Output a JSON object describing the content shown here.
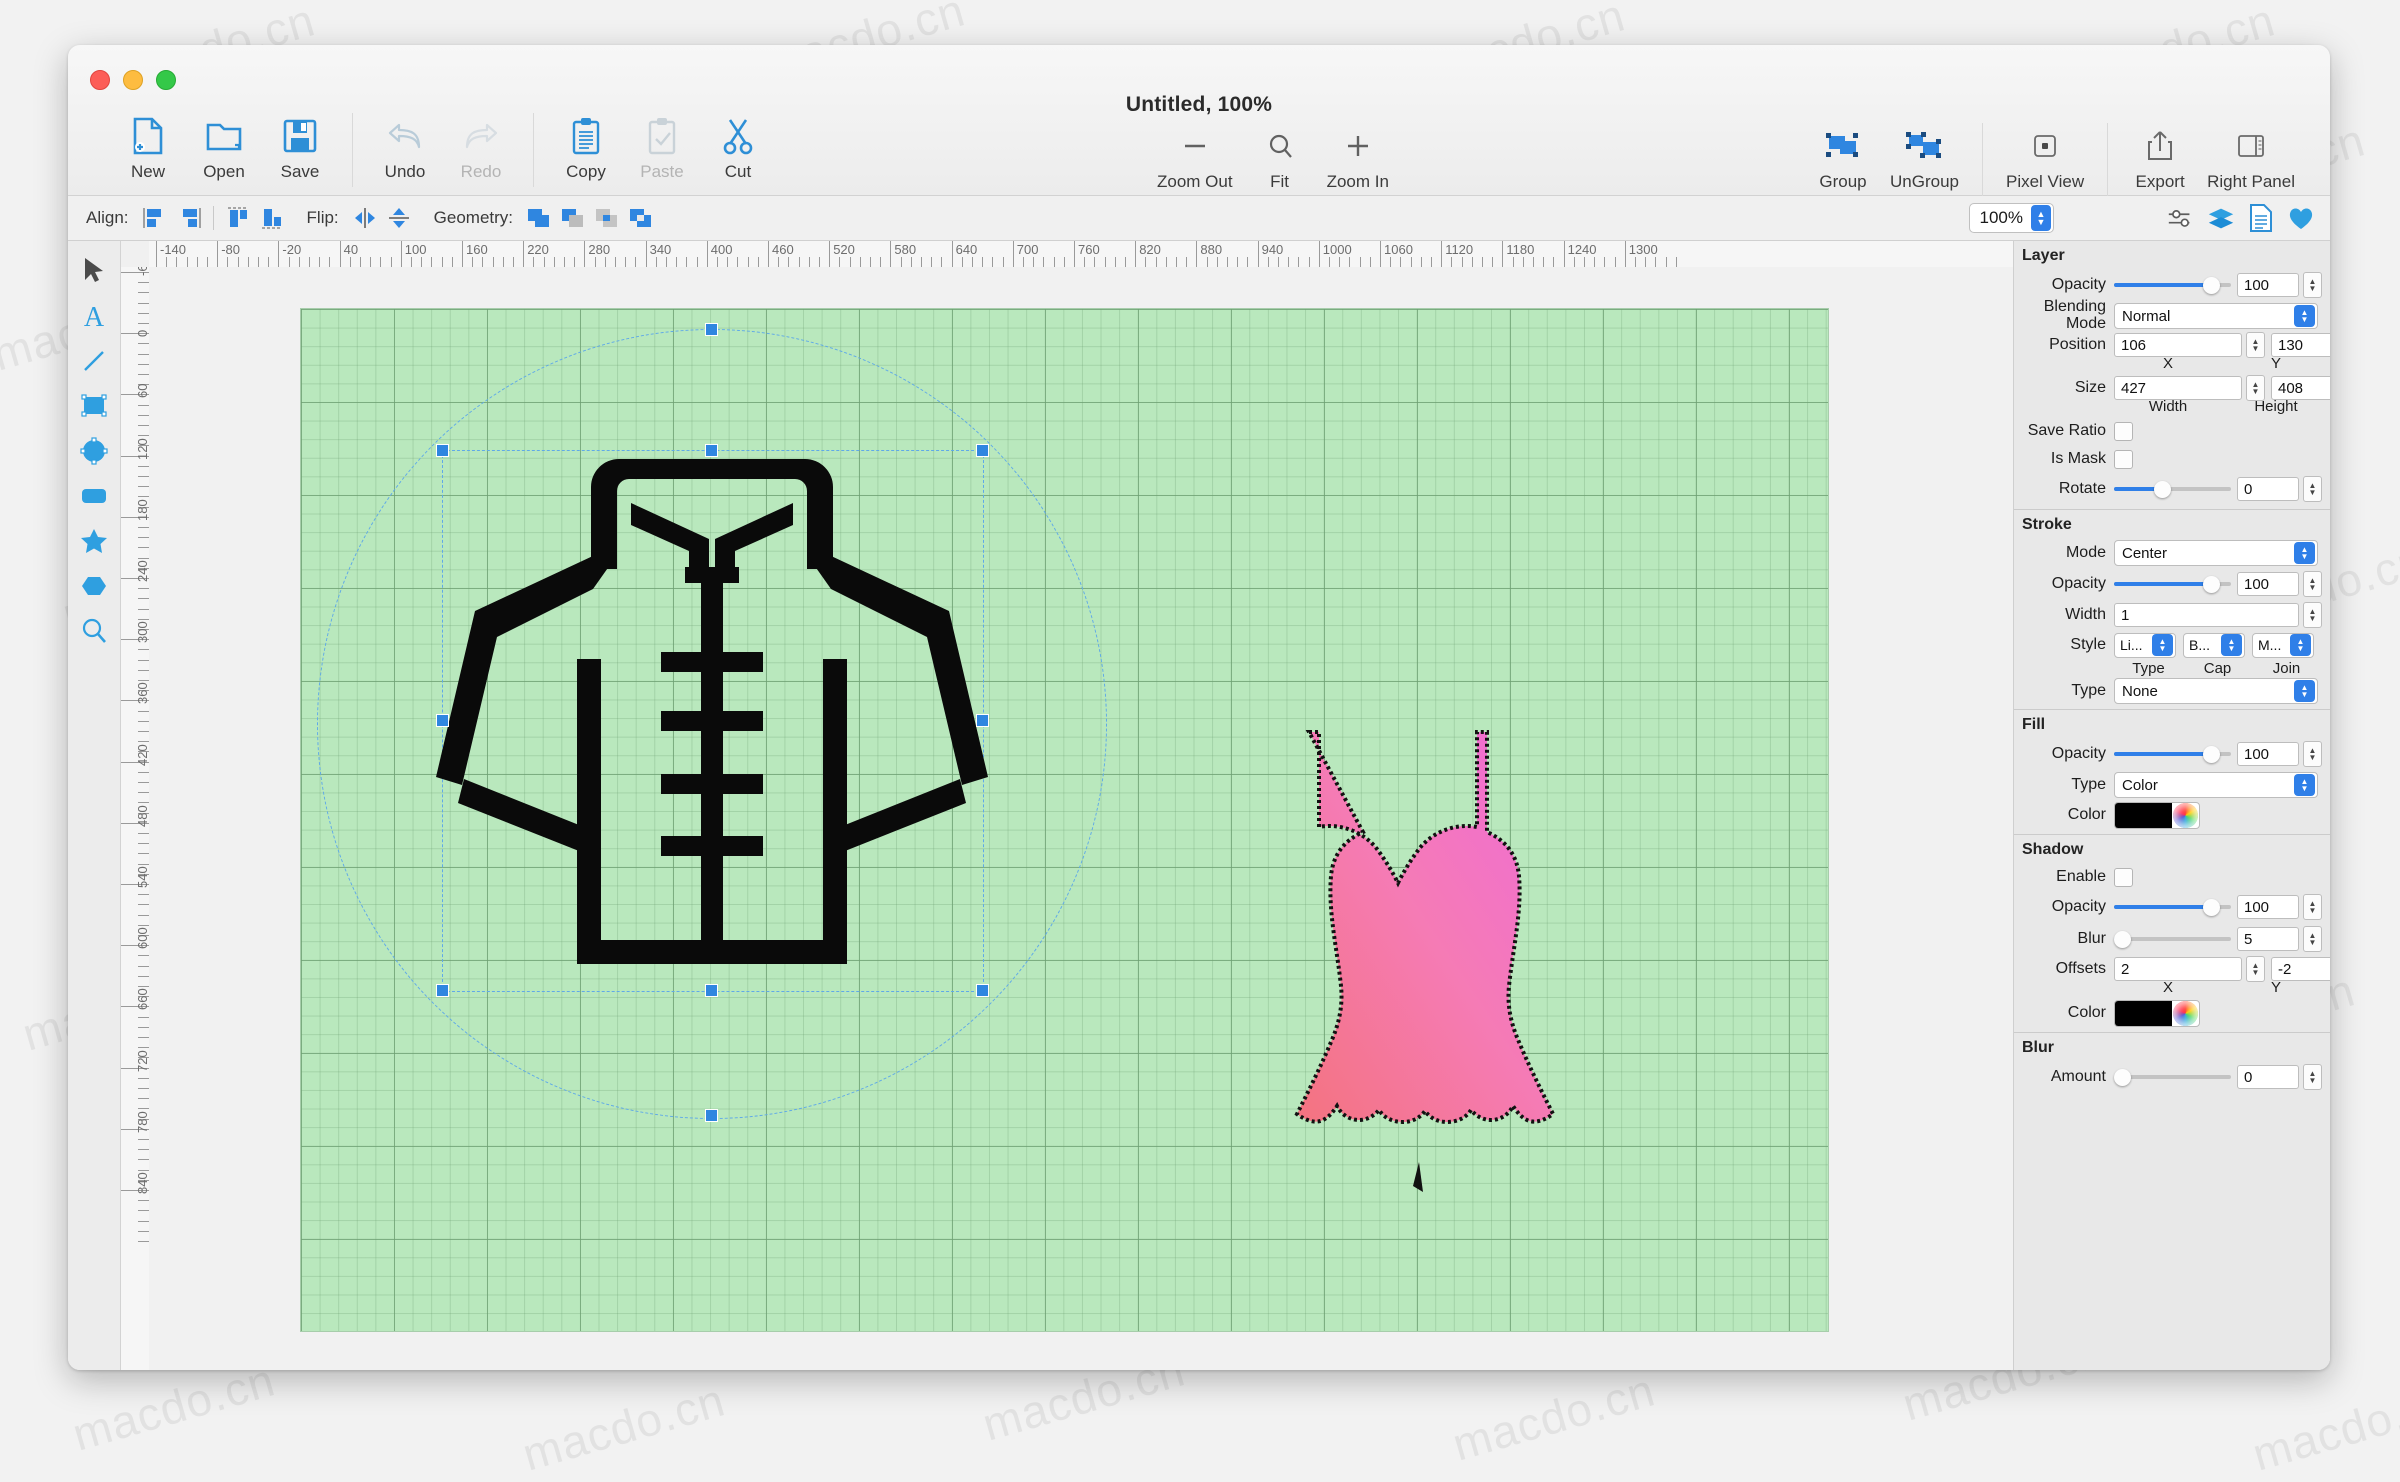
{
  "window": {
    "title": "Untitled, 100%",
    "traffic_lights": [
      "close",
      "minimize",
      "maximize"
    ]
  },
  "toolbar": {
    "left_items": [
      {
        "label": "New",
        "icon": "new-document-icon",
        "disabled": false
      },
      {
        "label": "Open",
        "icon": "open-folder-icon",
        "disabled": false
      },
      {
        "label": "Save",
        "icon": "save-floppy-icon",
        "disabled": false
      }
    ],
    "history_items": [
      {
        "label": "Undo",
        "icon": "undo-arrow-icon",
        "disabled": false
      },
      {
        "label": "Redo",
        "icon": "redo-arrow-icon",
        "disabled": true
      }
    ],
    "clipboard_items": [
      {
        "label": "Copy",
        "icon": "copy-clipboard-icon",
        "disabled": false
      },
      {
        "label": "Paste",
        "icon": "paste-clipboard-icon",
        "disabled": true
      },
      {
        "label": "Cut",
        "icon": "scissors-icon",
        "disabled": false
      }
    ],
    "zoom_items": [
      {
        "label": "Zoom Out",
        "icon": "minus-icon"
      },
      {
        "label": "Fit",
        "icon": "magnifier-icon"
      },
      {
        "label": "Zoom In",
        "icon": "plus-icon"
      }
    ],
    "right_items": [
      {
        "label": "Group",
        "icon": "group-shapes-icon"
      },
      {
        "label": "UnGroup",
        "icon": "ungroup-shapes-icon"
      },
      {
        "label": "Pixel View",
        "icon": "pixel-view-icon"
      },
      {
        "label": "Export",
        "icon": "export-share-icon"
      },
      {
        "label": "Right Panel",
        "icon": "right-panel-icon"
      }
    ]
  },
  "toolbar2": {
    "align_label": "Align:",
    "align_buttons": [
      "align-left",
      "align-right",
      "align-top",
      "align-bottom"
    ],
    "flip_label": "Flip:",
    "flip_buttons": [
      "flip-horizontal",
      "flip-vertical"
    ],
    "geometry_label": "Geometry:",
    "geometry_buttons": [
      "union",
      "subtract",
      "intersect",
      "exclude"
    ],
    "zoom_value": "100%",
    "right_icons": [
      "adjustments-icon",
      "layers-icon",
      "document-icon",
      "heart-icon"
    ]
  },
  "tools": [
    {
      "name": "select-arrow",
      "label": "Select"
    },
    {
      "name": "text",
      "label": "Text"
    },
    {
      "name": "line",
      "label": "Line"
    },
    {
      "name": "rectangle",
      "label": "Rectangle"
    },
    {
      "name": "ellipse",
      "label": "Ellipse"
    },
    {
      "name": "rounded-rectangle",
      "label": "Rounded Rectangle"
    },
    {
      "name": "star",
      "label": "Star"
    },
    {
      "name": "polygon",
      "label": "Polygon"
    },
    {
      "name": "zoom",
      "label": "Zoom"
    }
  ],
  "rulers": {
    "horizontal_ticks": [
      "-140",
      "-80",
      "-20",
      "40",
      "100",
      "160",
      "220",
      "280",
      "340",
      "400",
      "460",
      "520",
      "580",
      "640",
      "700",
      "760",
      "820",
      "880",
      "940",
      "1000",
      "1060",
      "1120",
      "1180",
      "1240",
      "1300"
    ],
    "vertical_ticks": [
      "-60",
      "0",
      "60",
      "120",
      "180",
      "240",
      "300",
      "360",
      "420",
      "480",
      "540",
      "600",
      "660",
      "720",
      "780",
      "840"
    ],
    "step": 60
  },
  "canvas": {
    "background_color": "#b9e8bd",
    "shapes": [
      {
        "name": "shirt-shape",
        "fill": "#000000",
        "selected": true
      },
      {
        "name": "dress-shape",
        "fill_from": "#f5737f",
        "fill_to": "#ef6bd8",
        "selected": false
      }
    ]
  },
  "panel": {
    "layer": {
      "title": "Layer",
      "opacity_label": "Opacity",
      "opacity_value": "100",
      "blending_label": "Blending",
      "mode_label": "Mode",
      "blending_value": "Normal",
      "position_label": "Position",
      "position_x": "106",
      "position_y": "130",
      "x_label": "X",
      "y_label": "Y",
      "size_label": "Size",
      "size_w": "427",
      "size_h": "408",
      "width_label": "Width",
      "height_label": "Height",
      "save_ratio_label": "Save Ratio",
      "save_ratio_checked": false,
      "is_mask_label": "Is Mask",
      "is_mask_checked": false,
      "rotate_label": "Rotate",
      "rotate_value": "0"
    },
    "stroke": {
      "title": "Stroke",
      "mode_label": "Mode",
      "mode_value": "Center",
      "opacity_label": "Opacity",
      "opacity_value": "100",
      "width_label": "Width",
      "width_value": "1",
      "style_label": "Style",
      "style_type": "Li...",
      "style_cap": "B...",
      "style_join": "M...",
      "type_sublabel": "Type",
      "cap_sublabel": "Cap",
      "join_sublabel": "Join",
      "type_label": "Type",
      "type_value": "None"
    },
    "fill": {
      "title": "Fill",
      "opacity_label": "Opacity",
      "opacity_value": "100",
      "type_label": "Type",
      "type_value": "Color",
      "color_label": "Color",
      "color_value": "#000000"
    },
    "shadow": {
      "title": "Shadow",
      "enable_label": "Enable",
      "enable_checked": false,
      "opacity_label": "Opacity",
      "opacity_value": "100",
      "blur_label": "Blur",
      "blur_value": "5",
      "offsets_label": "Offsets",
      "offset_x": "2",
      "offset_y": "-2",
      "x_label": "X",
      "y_label": "Y",
      "color_label": "Color",
      "color_value": "#000000"
    },
    "blur": {
      "title": "Blur",
      "amount_label": "Amount",
      "amount_value": "0"
    }
  },
  "watermark": {
    "text": "macdo.cn"
  }
}
